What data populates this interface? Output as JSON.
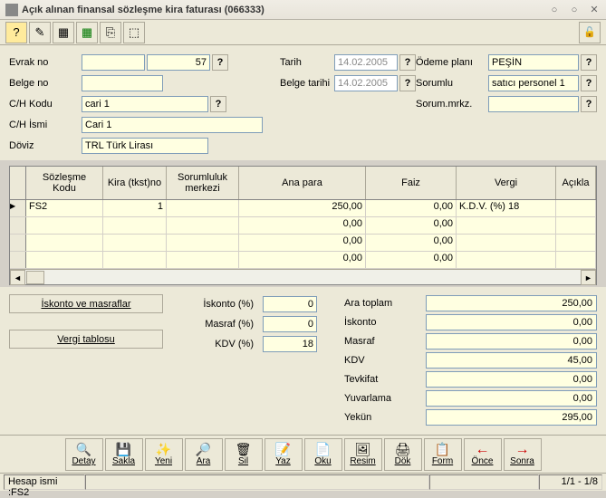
{
  "window": {
    "title": "Açık alınan finansal sözleşme kira faturası (066333)"
  },
  "form": {
    "evrak_no_label": "Evrak no",
    "evrak_no": "57",
    "belge_no_label": "Belge no",
    "belge_no": "",
    "ch_kodu_label": "C/H Kodu",
    "ch_kodu": "cari 1",
    "ch_ismi_label": "C/H İsmi",
    "ch_ismi": "Cari 1",
    "doviz_label": "Döviz",
    "doviz": "TRL Türk Lirası",
    "tarih_label": "Tarih",
    "tarih": "14.02.2005",
    "belge_tarihi_label": "Belge tarihi",
    "belge_tarihi": "14.02.2005",
    "odeme_plani_label": "Ödeme planı",
    "odeme_plani": "PEŞİN",
    "sorumlu_label": "Sorumlu",
    "sorumlu": "satıcı personel 1",
    "sorum_mrkz_label": "Sorum.mrkz.",
    "sorum_mrkz": ""
  },
  "grid": {
    "headers": {
      "sozlesme_kodu": "Sözleşme Kodu",
      "kira_tkst_no": "Kira (tkst)no",
      "sorumluluk_merkezi": "Sorumluluk merkezi",
      "ana_para": "Ana para",
      "faiz": "Faiz",
      "vergi": "Vergi",
      "aciklama": "Açıkla"
    },
    "rows": [
      {
        "sozlesme_kodu": "FS2",
        "kira_no": "1",
        "sorumluluk": "",
        "ana_para": "250,00",
        "faiz": "0,00",
        "vergi": "K.D.V. (%) 18"
      },
      {
        "sozlesme_kodu": "",
        "kira_no": "",
        "sorumluluk": "",
        "ana_para": "0,00",
        "faiz": "0,00",
        "vergi": ""
      },
      {
        "sozlesme_kodu": "",
        "kira_no": "",
        "sorumluluk": "",
        "ana_para": "0,00",
        "faiz": "0,00",
        "vergi": ""
      },
      {
        "sozlesme_kodu": "",
        "kira_no": "",
        "sorumluluk": "",
        "ana_para": "0,00",
        "faiz": "0,00",
        "vergi": ""
      }
    ]
  },
  "buttons": {
    "iskonto_masraflar": "İskonto ve masraflar",
    "vergi_tablosu": "Vergi tablosu"
  },
  "mid": {
    "iskonto_pct_label": "İskonto (%)",
    "iskonto_pct": "0",
    "masraf_pct_label": "Masraf (%)",
    "masraf_pct": "0",
    "kdv_pct_label": "KDV    (%)",
    "kdv_pct": "18"
  },
  "totals": {
    "ara_toplam_label": "Ara toplam",
    "ara_toplam": "250,00",
    "iskonto_label": "İskonto",
    "iskonto": "0,00",
    "masraf_label": "Masraf",
    "masraf": "0,00",
    "kdv_label": "KDV",
    "kdv": "45,00",
    "tevkifat_label": "Tevkifat",
    "tevkifat": "0,00",
    "yuvarlama_label": "Yuvarlama",
    "yuvarlama": "0,00",
    "yekun_label": "Yekün",
    "yekun": "295,00"
  },
  "actions": {
    "detay": "Detay",
    "sakla": "Sakla",
    "yeni": "Yeni",
    "ara": "Ara",
    "sil": "Sil",
    "yaz": "Yaz",
    "oku": "Oku",
    "resim": "Resim",
    "dok": "Dök",
    "form": "Form",
    "once": "Önce",
    "sonra": "Sonra"
  },
  "status": {
    "hesap": "Hesap ismi :FS2",
    "pager": "1/1 - 1/8"
  }
}
